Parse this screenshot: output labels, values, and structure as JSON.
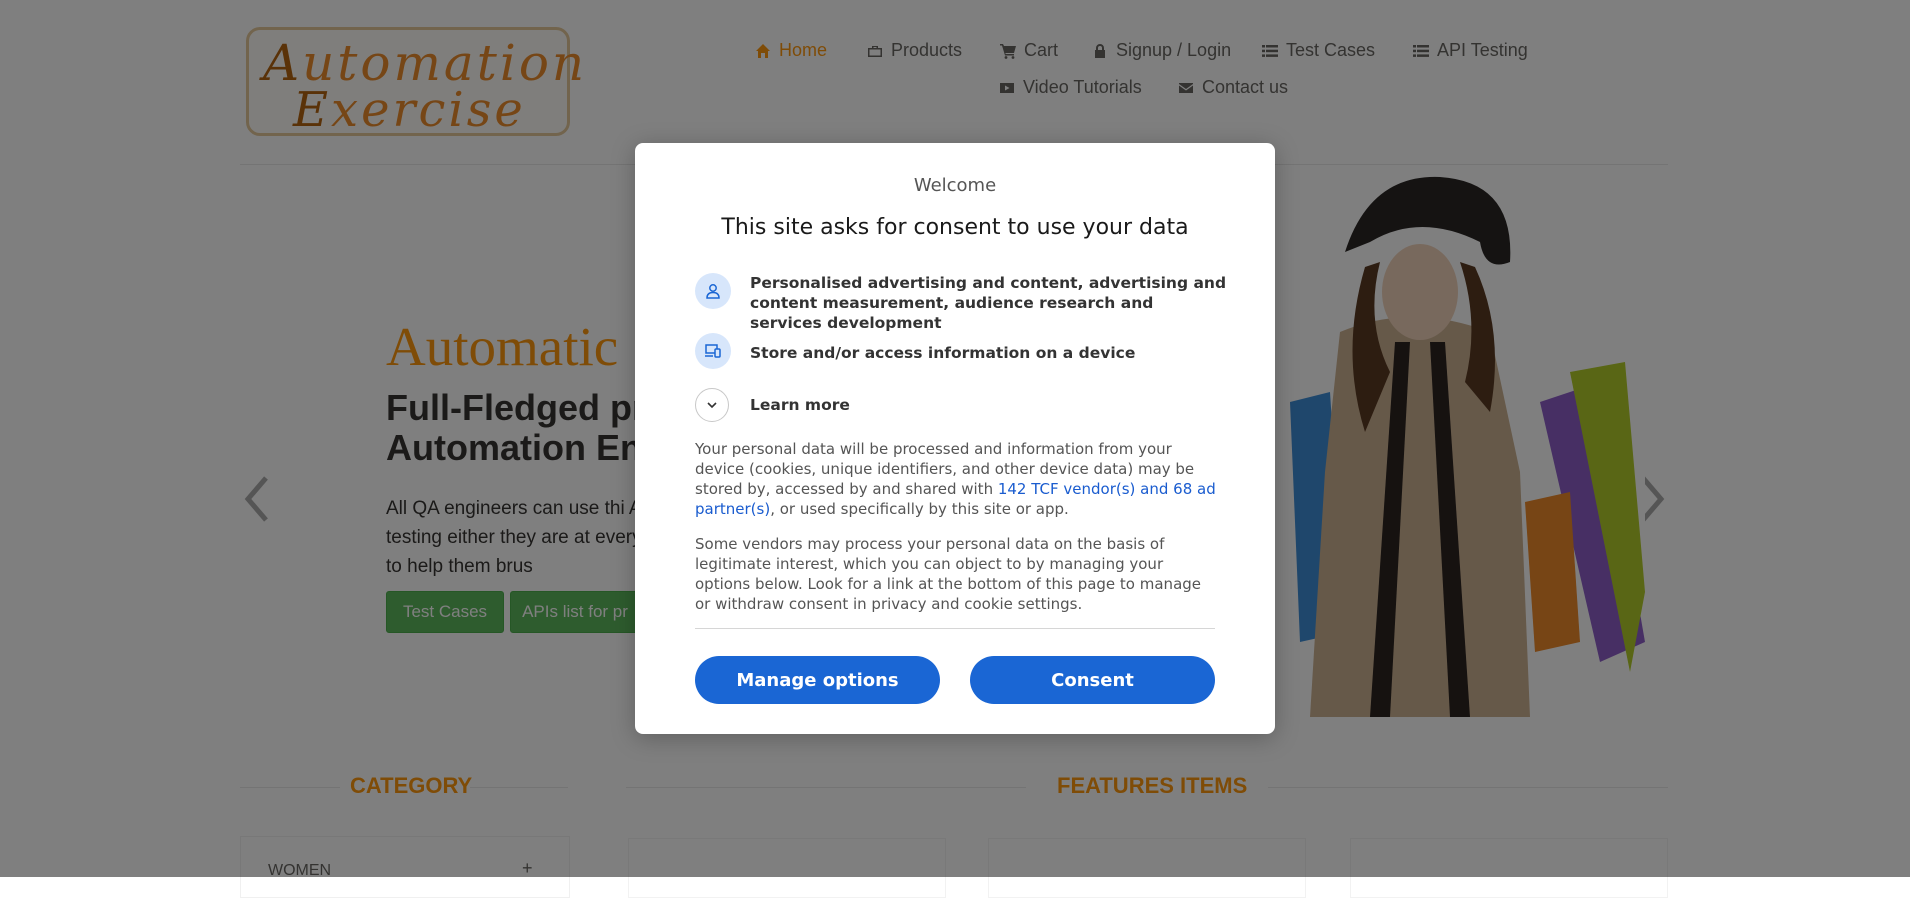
{
  "header": {
    "logo_line1_cap": "A",
    "logo_line1_rest": "utomation",
    "logo_line2_cap": "E",
    "logo_line2_rest": "xercise",
    "nav": {
      "home": "Home",
      "products": "Products",
      "cart": "Cart",
      "signup": "Signup / Login",
      "test_cases": "Test Cases",
      "api_testing": "API Testing",
      "video_tutorials": "Video Tutorials",
      "contact_us": "Contact us"
    },
    "accent_color": "#fe980f"
  },
  "hero": {
    "title": "Automatic",
    "subtitle": "Full-Fledged pra Automation Eng",
    "description": "All QA engineers can use thi API testing either they are at everybody to help them brus",
    "button_test_cases": "Test Cases",
    "button_apis": "APIs list for pr"
  },
  "sections": {
    "category_title": "CATEGORY",
    "category_first_item": "WOMEN",
    "category_expand": "+",
    "features_title": "FEATURES ITEMS"
  },
  "consent": {
    "welcome": "Welcome",
    "heading": "This site asks for consent to use your data",
    "purposes": [
      {
        "icon": "person-icon",
        "text": "Personalised advertising and content, advertising and content measurement, audience research and services development"
      },
      {
        "icon": "devices-icon",
        "text": "Store and/or access information on a device"
      }
    ],
    "learn_more": "Learn more",
    "paragraph1_before": "Your personal data will be processed and information from your device (cookies, unique identifiers, and other device data) may be stored by, accessed by and shared with ",
    "paragraph1_link": "142 TCF vendor(s) and 68 ad partner(s)",
    "paragraph1_after": ", or used specifically by this site or app.",
    "paragraph2": "Some vendors may process your personal data on the basis of legitimate interest, which you can object to by managing your options below. Look for a link at the bottom of this page to manage or withdraw consent in privacy and cookie settings.",
    "manage_options": "Manage options",
    "consent_button": "Consent",
    "button_color": "#1a66d4"
  }
}
